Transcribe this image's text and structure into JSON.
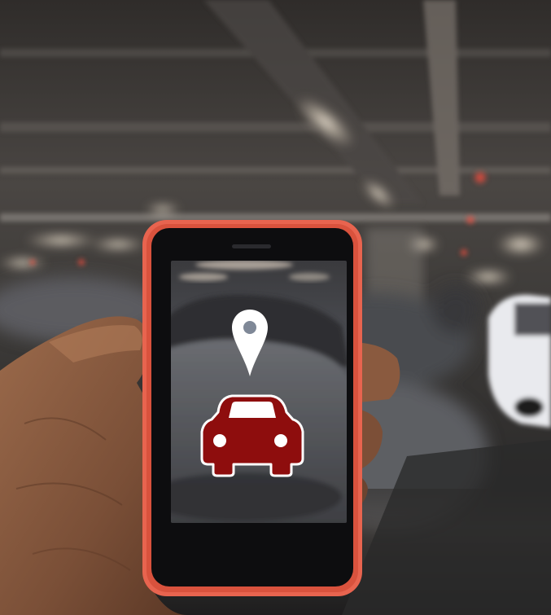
{
  "scene": {
    "description_names": {
      "background": "parking-garage-background",
      "hand": "hand",
      "phone": "smartphone",
      "screen": "phone-screen",
      "pin": "location-pin-icon",
      "car": "car-icon"
    },
    "colors": {
      "phone_case": "#e8644f",
      "phone_bezel": "#0d0d0f",
      "car_icon_fill": "#8e0d0d",
      "car_icon_outline": "#ffffff",
      "pin_fill": "#ffffff",
      "pin_hole": "#7f8897",
      "ceiling": "#3d3a37",
      "skin": "#8a5a3f",
      "floor": "#2c2b2b"
    }
  }
}
